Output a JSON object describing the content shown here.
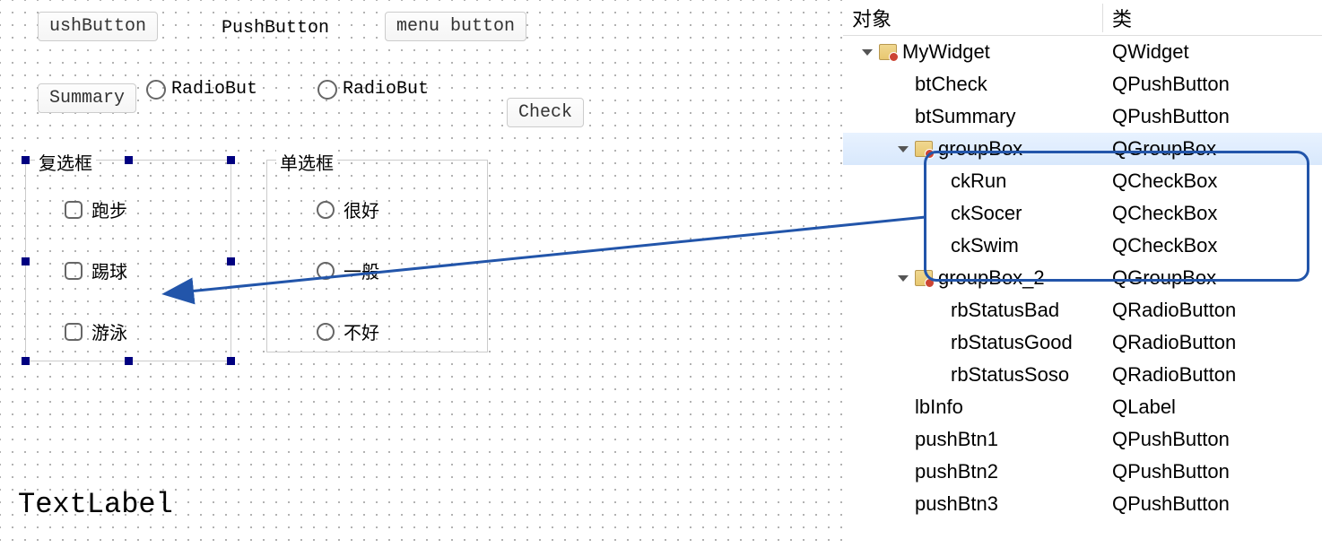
{
  "canvas": {
    "btn_ush": "ushButton",
    "btn_push": "PushButton",
    "btn_menu": "menu button",
    "btn_summary": "Summary",
    "btn_radio1": "RadioBut",
    "btn_radio2": "RadioBut",
    "btn_check": "Check",
    "groupbox1": {
      "title": "复选框",
      "items": [
        "跑步",
        "踢球",
        "游泳"
      ]
    },
    "groupbox2": {
      "title": "单选框",
      "items": [
        "很好",
        "一般",
        "不好"
      ]
    },
    "text_label": "TextLabel"
  },
  "inspector": {
    "header_obj": "对象",
    "header_class": "类",
    "rows": [
      {
        "indent": 0,
        "arrow": true,
        "icon": true,
        "name": "MyWidget",
        "class": "QWidget"
      },
      {
        "indent": 1,
        "arrow": false,
        "icon": false,
        "name": "btCheck",
        "class": "QPushButton"
      },
      {
        "indent": 1,
        "arrow": false,
        "icon": false,
        "name": "btSummary",
        "class": "QPushButton"
      },
      {
        "indent": 1,
        "arrow": true,
        "icon": true,
        "name": "groupBox",
        "class": "QGroupBox",
        "selected": true
      },
      {
        "indent": 2,
        "arrow": false,
        "icon": false,
        "name": "ckRun",
        "class": "QCheckBox"
      },
      {
        "indent": 2,
        "arrow": false,
        "icon": false,
        "name": "ckSocer",
        "class": "QCheckBox"
      },
      {
        "indent": 2,
        "arrow": false,
        "icon": false,
        "name": "ckSwim",
        "class": "QCheckBox"
      },
      {
        "indent": 1,
        "arrow": true,
        "icon": true,
        "name": "groupBox_2",
        "class": "QGroupBox"
      },
      {
        "indent": 2,
        "arrow": false,
        "icon": false,
        "name": "rbStatusBad",
        "class": "QRadioButton"
      },
      {
        "indent": 2,
        "arrow": false,
        "icon": false,
        "name": "rbStatusGood",
        "class": "QRadioButton"
      },
      {
        "indent": 2,
        "arrow": false,
        "icon": false,
        "name": "rbStatusSoso",
        "class": "QRadioButton"
      },
      {
        "indent": 1,
        "arrow": false,
        "icon": false,
        "name": "lbInfo",
        "class": "QLabel"
      },
      {
        "indent": 1,
        "arrow": false,
        "icon": false,
        "name": "pushBtn1",
        "class": "QPushButton"
      },
      {
        "indent": 1,
        "arrow": false,
        "icon": false,
        "name": "pushBtn2",
        "class": "QPushButton"
      },
      {
        "indent": 1,
        "arrow": false,
        "icon": false,
        "name": "pushBtn3",
        "class": "QPushButton"
      }
    ]
  }
}
